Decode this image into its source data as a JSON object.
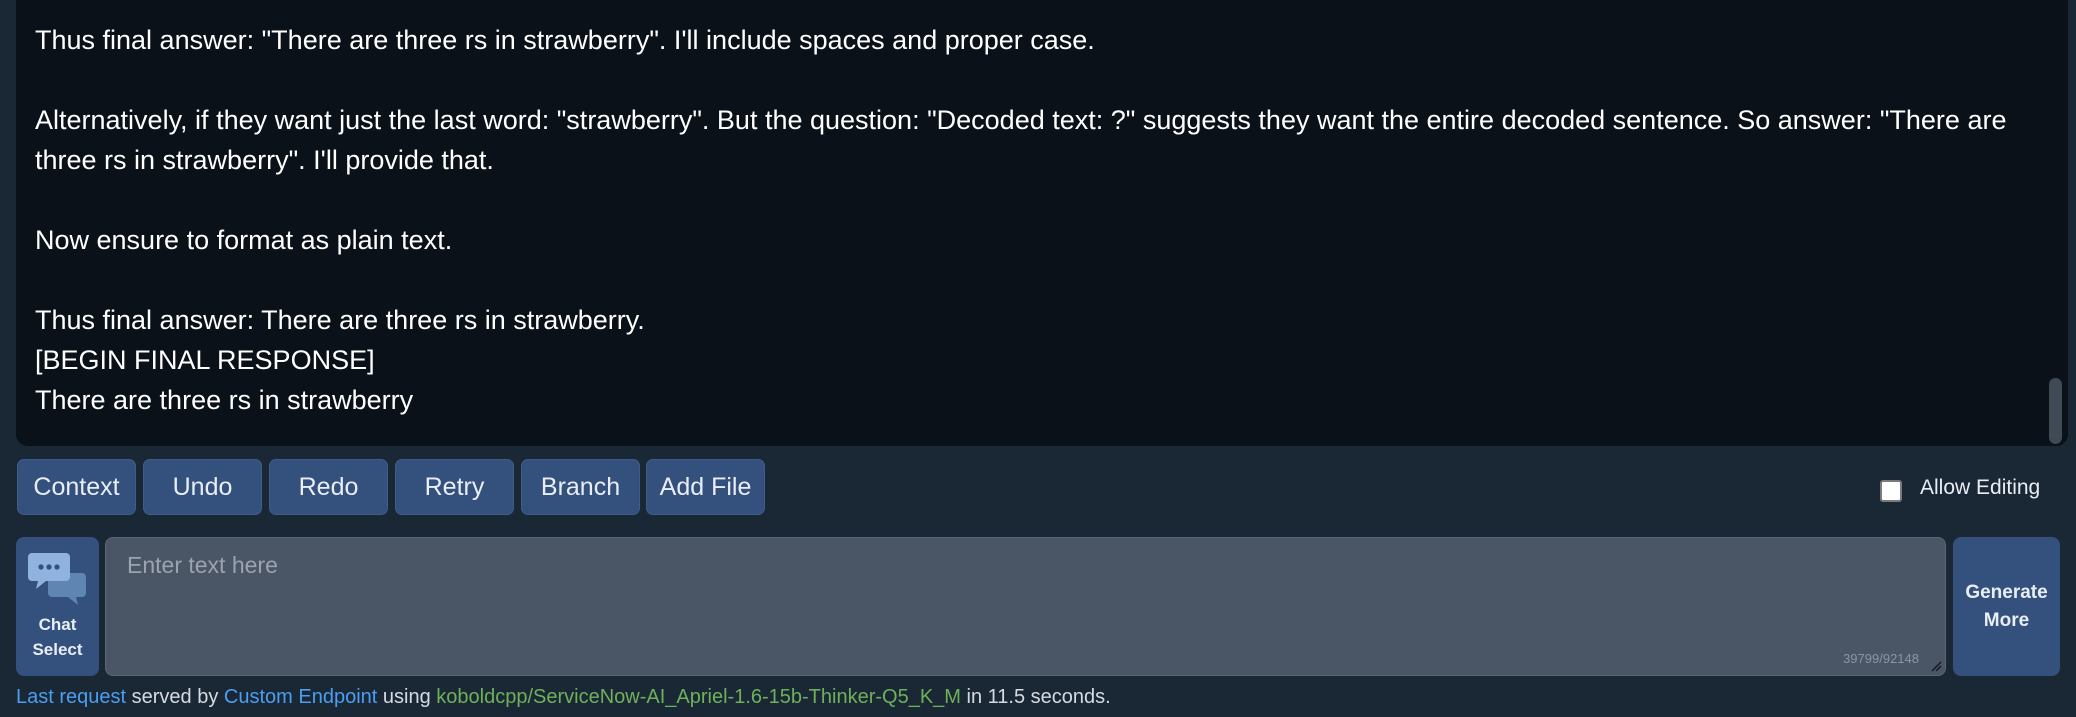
{
  "chat": {
    "lines": [
      "Thus final answer: \"There are three rs in strawberry\". I'll include spaces and proper case.",
      "Alternatively, if they want just the last word: \"strawberry\". But the question: \"Decoded text: ?\" suggests they want the entire decoded sentence. So answer: \"There are three rs in strawberry\". I'll provide that.",
      "Now ensure to format as plain text.",
      "Thus final answer: There are three rs in strawberry.",
      "[BEGIN FINAL RESPONSE]",
      "There are three rs in strawberry"
    ]
  },
  "toolbar": {
    "context": "Context",
    "undo": "Undo",
    "redo": "Redo",
    "retry": "Retry",
    "branch": "Branch",
    "add_file": "Add File",
    "allow_editing": "Allow Editing",
    "allow_editing_checked": false
  },
  "input": {
    "chat_select_label": "Chat\nSelect",
    "chat_select_icon": "chat-bubbles-icon",
    "placeholder": "Enter text here",
    "value": "",
    "token_count": "39799/92148",
    "generate_label": "Generate\nMore"
  },
  "status": {
    "last_request": "Last request",
    "served_by": "served by",
    "endpoint": "Custom Endpoint",
    "using": "using",
    "model": "koboldcpp/ServiceNow-AI_Apriel-1.6-15b-Thinker-Q5_K_M",
    "time": "in 11.5 seconds."
  },
  "colors": {
    "background": "#1a2735",
    "chat_background": "#0a1118",
    "button": "#34507c",
    "input": "#4a5566",
    "link_blue": "#4c9ef0",
    "link_green": "#6fb05a"
  }
}
